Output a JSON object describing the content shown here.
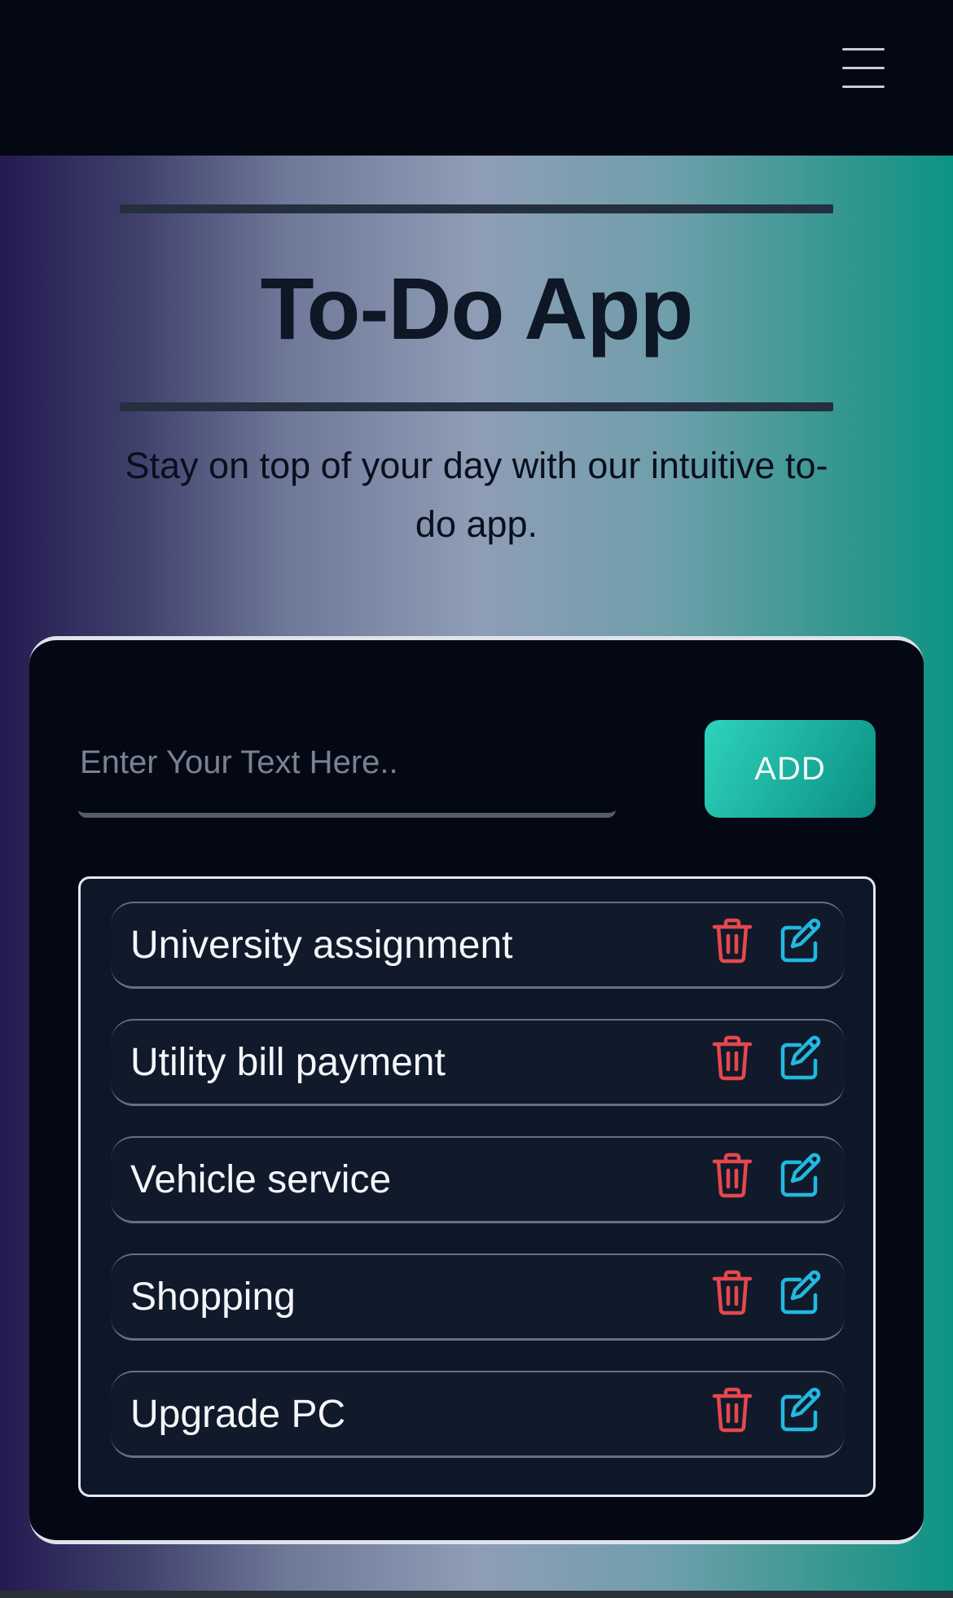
{
  "header": {
    "menu_icon": "hamburger-menu-icon"
  },
  "hero": {
    "title": "To-Do App",
    "subtitle": "Stay on top of your day with our intuitive to-do app."
  },
  "form": {
    "input_placeholder": "Enter Your Text Here..",
    "input_value": "",
    "add_label": "ADD"
  },
  "tasks": [
    {
      "text": "University assignment",
      "delete_icon": "trash-icon",
      "edit_icon": "pencil-square-icon"
    },
    {
      "text": "Utility bill payment",
      "delete_icon": "trash-icon",
      "edit_icon": "pencil-square-icon"
    },
    {
      "text": "Vehicle service",
      "delete_icon": "trash-icon",
      "edit_icon": "pencil-square-icon"
    },
    {
      "text": "Shopping",
      "delete_icon": "trash-icon",
      "edit_icon": "pencil-square-icon"
    },
    {
      "text": "Upgrade PC",
      "delete_icon": "trash-icon",
      "edit_icon": "pencil-square-icon"
    }
  ],
  "colors": {
    "accent_teal": "#2ed3bc",
    "delete_red": "#e5484d",
    "edit_cyan": "#22b8e0",
    "card_bg": "#040814"
  }
}
